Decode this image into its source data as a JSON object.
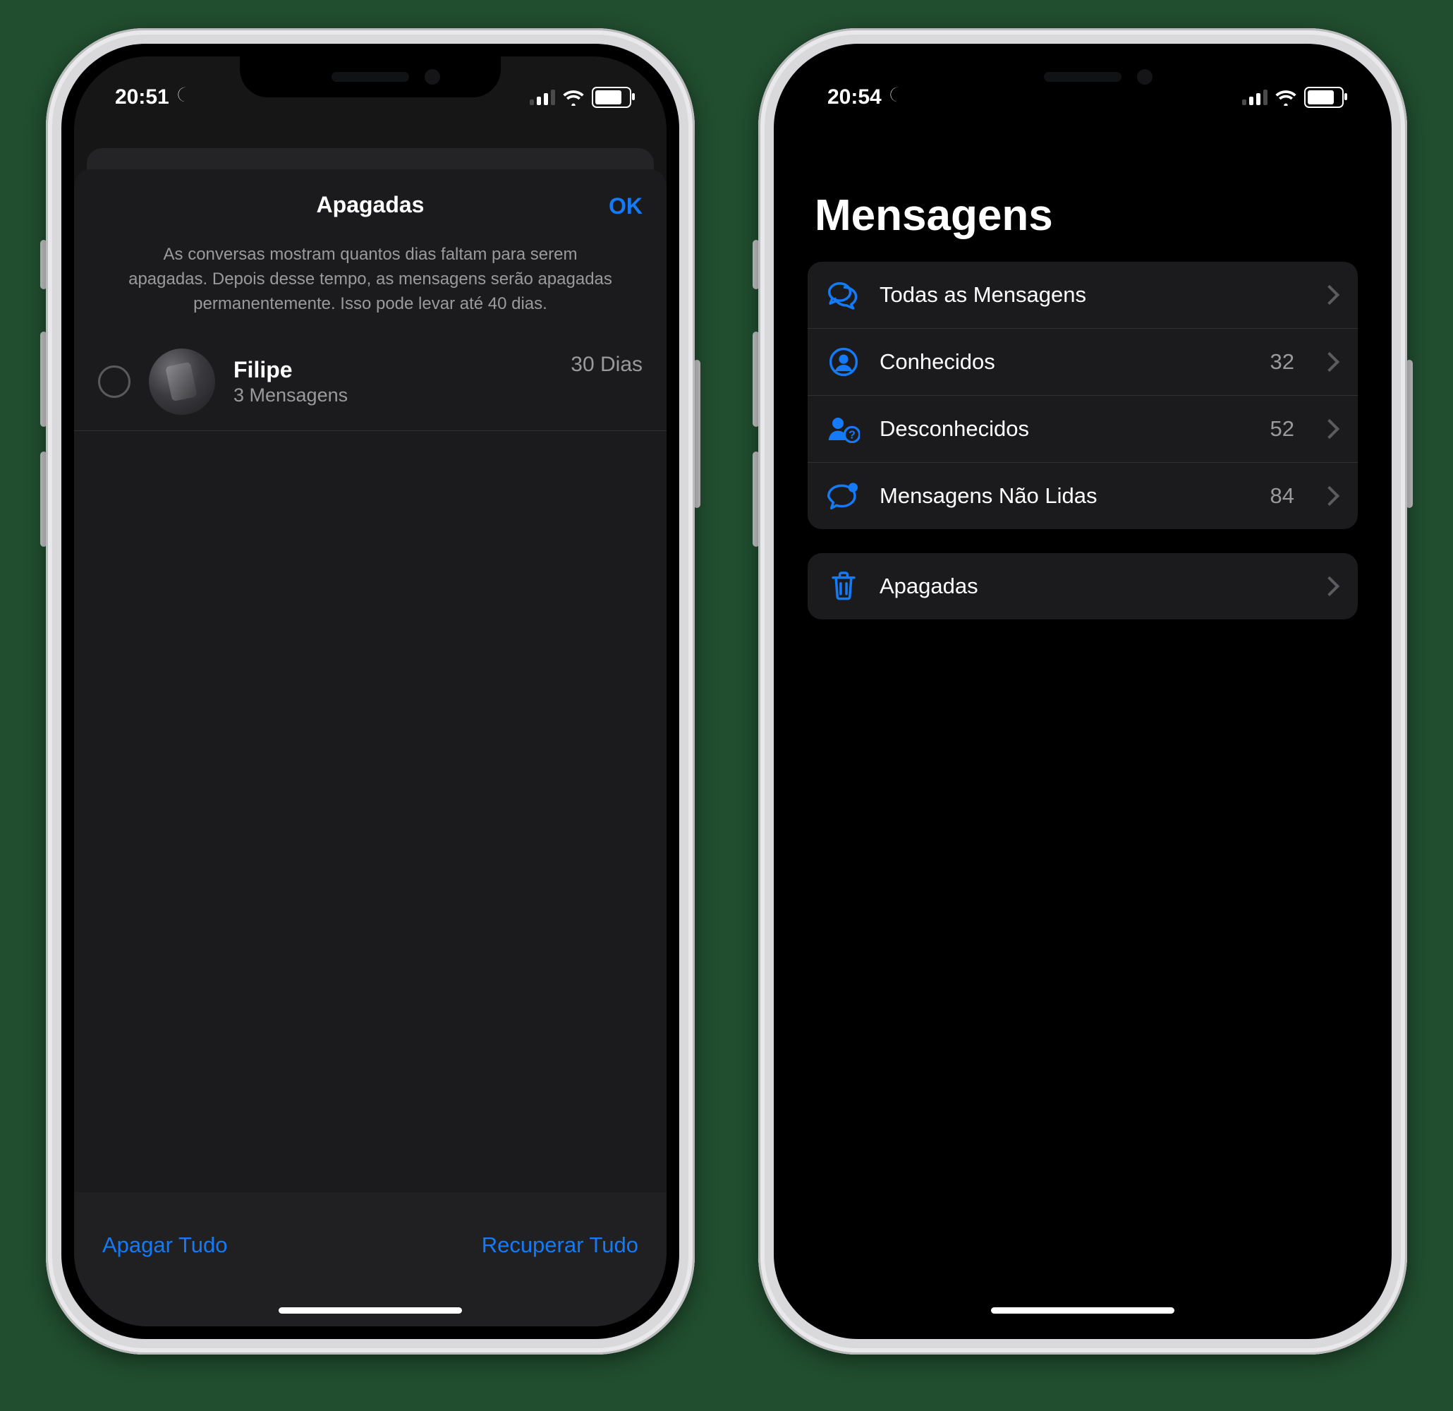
{
  "colors": {
    "accent": "#147af6",
    "background_page": "#214e2f",
    "text_secondary": "#9a9a9d"
  },
  "left": {
    "status": {
      "time": "20:51"
    },
    "modal": {
      "title": "Apagadas",
      "ok": "OK",
      "description": "As conversas mostram quantos dias faltam para serem apagadas. Depois desse tempo, as mensagens serão apagadas permanentemente. Isso pode levar até 40 dias."
    },
    "conversation": {
      "name": "Filipe",
      "subtitle": "3 Mensagens",
      "days": "30 Dias"
    },
    "toolbar": {
      "delete_all": "Apagar Tudo",
      "recover_all": "Recuperar Tudo"
    }
  },
  "right": {
    "status": {
      "time": "20:54"
    },
    "title": "Mensagens",
    "filters": [
      {
        "icon": "chat-bubbles-icon",
        "label": "Todas as Mensagens",
        "count": ""
      },
      {
        "icon": "person-circle-icon",
        "label": "Conhecidos",
        "count": "32"
      },
      {
        "icon": "person-question-icon",
        "label": "Desconhecidos",
        "count": "52"
      },
      {
        "icon": "unread-bubble-icon",
        "label": "Mensagens Não Lidas",
        "count": "84"
      }
    ],
    "deleted": {
      "icon": "trash-icon",
      "label": "Apagadas"
    }
  }
}
